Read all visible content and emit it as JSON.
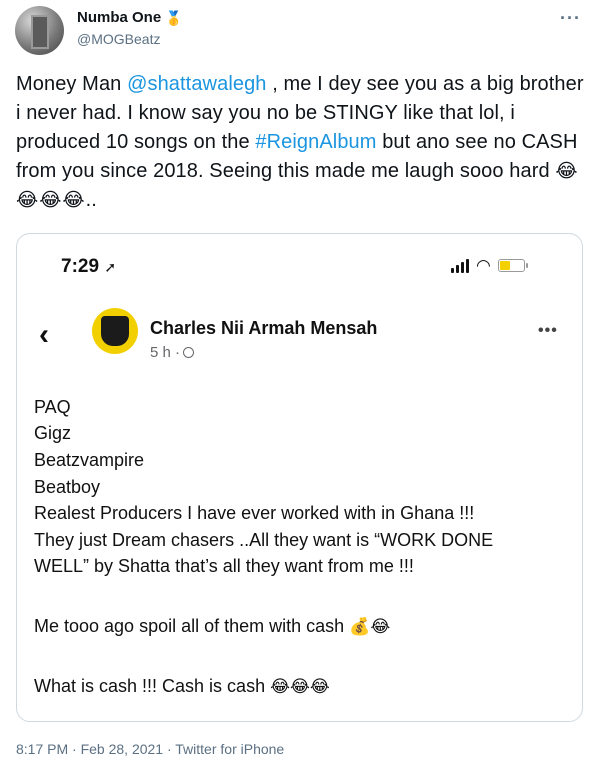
{
  "author": {
    "display_name": "Numba One",
    "badge_icon": "medal-icon",
    "handle": "@MOGBeatz"
  },
  "tweet": {
    "text_part1": "Money Man ",
    "mention": "@shattawalegh",
    "text_part2": " , me I dey see you as a big brother i never had. I know say you no be STINGY like that lol, i produced 10 songs on the ",
    "hashtag": "#ReignAlbum",
    "text_part3": " but ano see no CASH from you since 2018. Seeing this made me laugh sooo hard ",
    "emojis": "😂😂😂😂",
    "trailing": "..",
    "link_color": "#1b95e0"
  },
  "screenshot": {
    "status_time": "7:29",
    "fb_name": "Charles Nii Armah Mensah",
    "fb_time": "5 h ·",
    "post_lines": [
      "PAQ",
      "Gigz",
      "Beatzvampire",
      "Beatboy",
      "Realest Producers I have ever worked with in Ghana !!!",
      "They just Dream chasers ..All they want is “WORK DONE",
      "WELL” by Shatta that’s all they want from me !!!",
      "Me tooo ago spoil all of them with cash",
      "What is cash !!! Cash is cash"
    ],
    "line8_emojis": "💰😂",
    "line9_emojis": "😂😂😂"
  },
  "footer": {
    "timestamp": "8:17 PM · Feb 28, 2021 · Twitter for iPhone"
  }
}
